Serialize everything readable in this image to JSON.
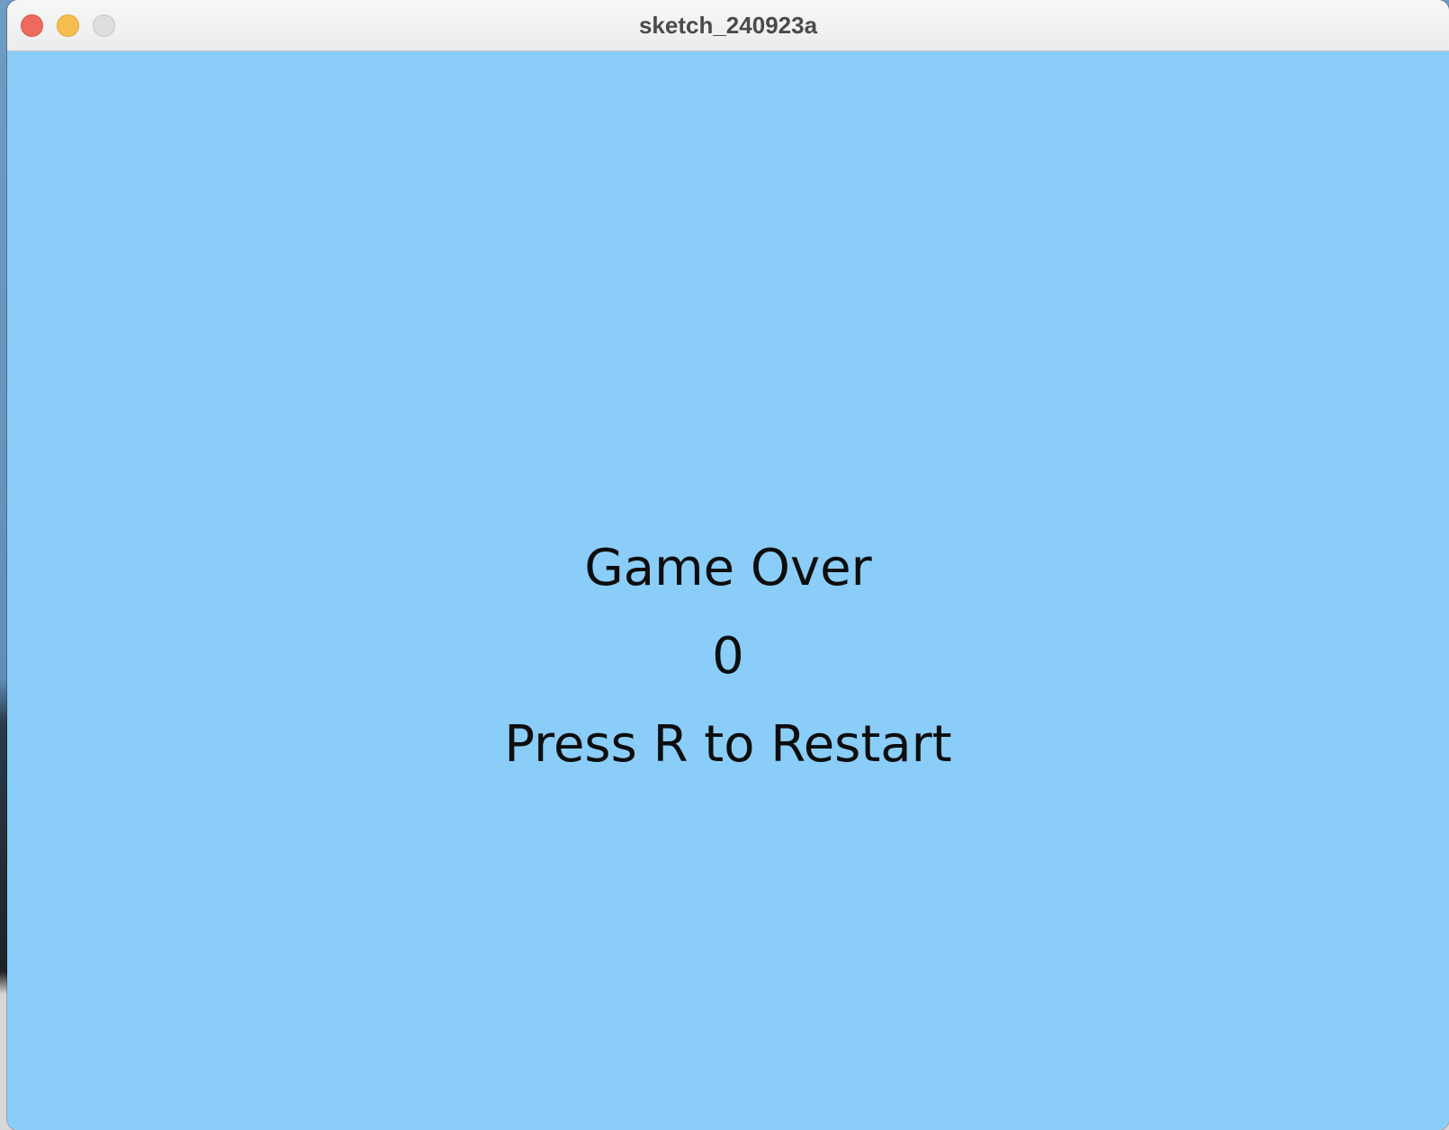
{
  "window": {
    "title": "sketch_240923a",
    "controls": {
      "close": "close-icon",
      "minimize": "minimize-icon",
      "zoom": "zoom-icon"
    }
  },
  "game": {
    "background_color": "#8acdf8",
    "text_color": "#0d0d0d",
    "game_over_label": "Game Over",
    "score": "0",
    "restart_hint": "Press R to Restart"
  }
}
